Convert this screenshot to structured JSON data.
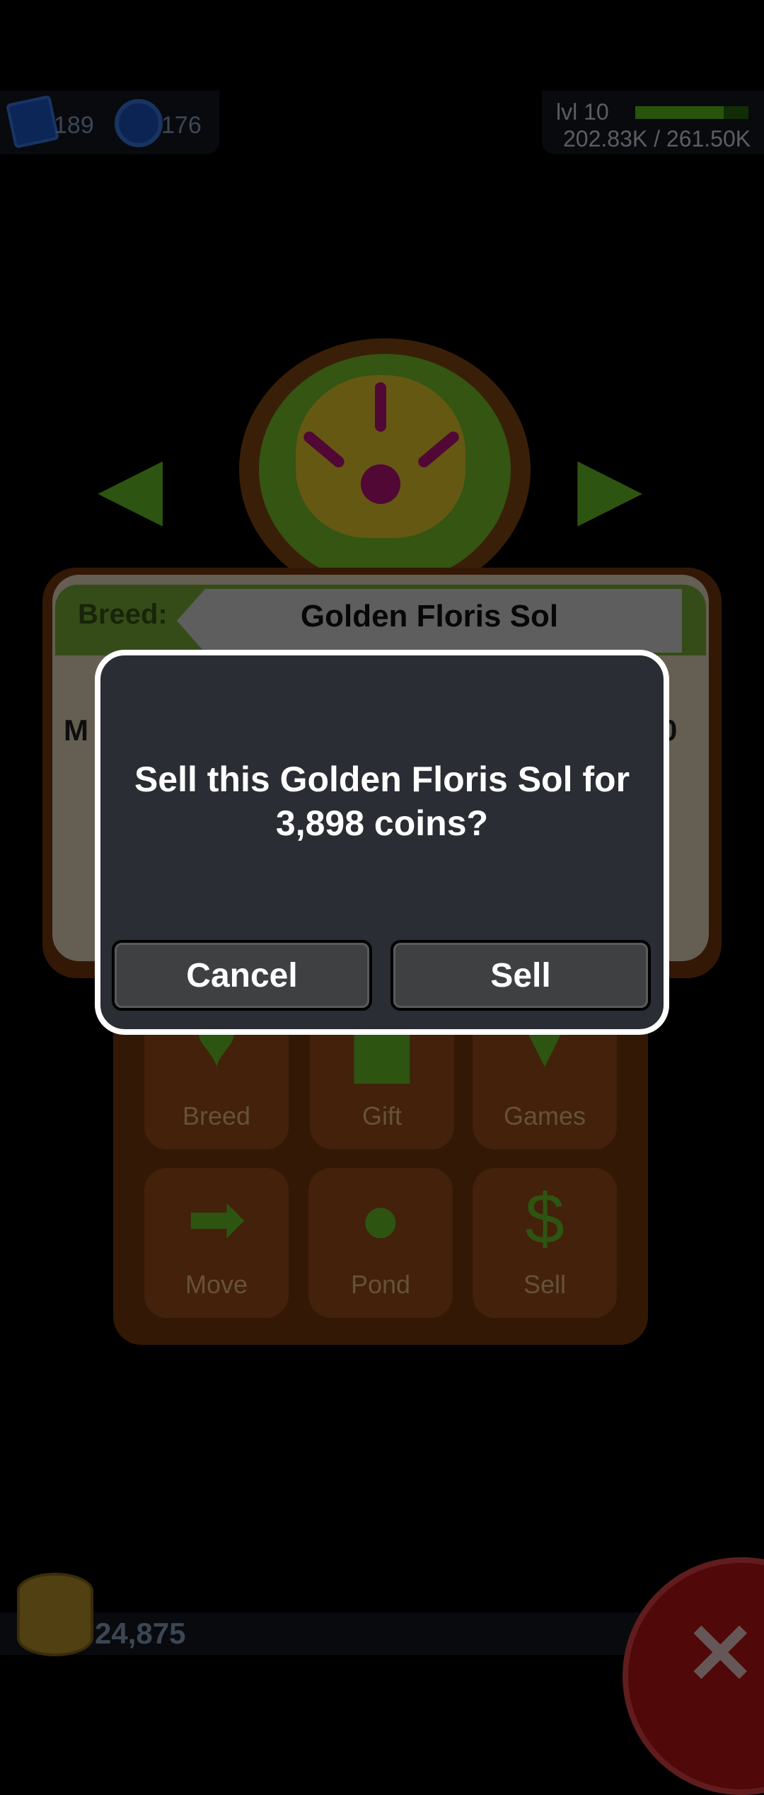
{
  "hud": {
    "gems": "189",
    "orbs": "176",
    "level": "lvl 10",
    "xp_text": "202.83K / 261.50K",
    "xp_progress": 0.78
  },
  "frog_card": {
    "breed_label": "Breed:",
    "breed_name": "Golden Floris Sol",
    "partial_left": "M",
    "partial_right": "0"
  },
  "actions": [
    {
      "label": "Breed",
      "icon": "heart-icon"
    },
    {
      "label": "Gift",
      "icon": "gift-icon"
    },
    {
      "label": "Games",
      "icon": "spinner-icon"
    },
    {
      "label": "Move",
      "icon": "arrow-right-icon"
    },
    {
      "label": "Pond",
      "icon": "lilypad-icon"
    },
    {
      "label": "Sell",
      "icon": "dollar-icon"
    }
  ],
  "footer": {
    "coins": "24,875",
    "close_icon": "close-icon"
  },
  "dialog": {
    "message": "Sell this Golden Floris Sol for 3,898 coins?",
    "cancel_label": "Cancel",
    "sell_label": "Sell"
  },
  "colors": {
    "dialog_bg": "#2a2d33",
    "dialog_border": "#ffffff",
    "button_bg": "#3f4042"
  }
}
